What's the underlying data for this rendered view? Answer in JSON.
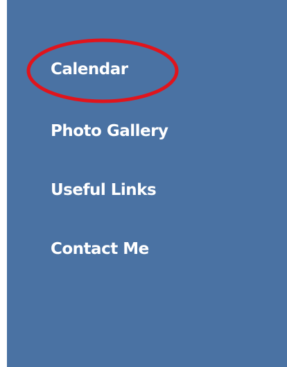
{
  "nav": {
    "items": [
      {
        "label": "Calendar"
      },
      {
        "label": "Photo Gallery"
      },
      {
        "label": "Useful Links"
      },
      {
        "label": "Contact Me"
      }
    ]
  },
  "colors": {
    "panel_background": "#4a72a3",
    "link_text": "#ffffff",
    "highlight_stroke": "#e0141c"
  }
}
